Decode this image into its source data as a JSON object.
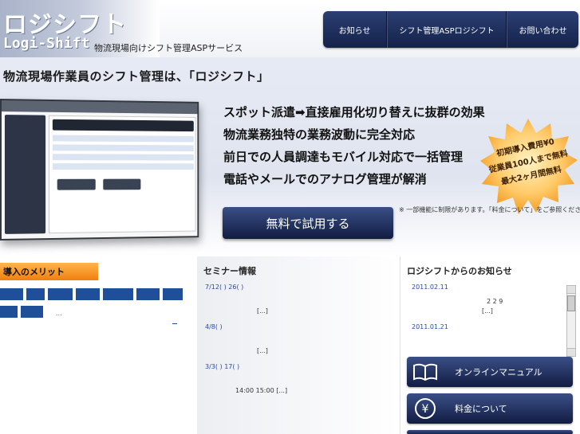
{
  "header": {
    "logo_jp": "ロジシフト",
    "logo_en": "Logi-Shift",
    "tagline": "物流現場向けシフト管理ASPサービス"
  },
  "nav": {
    "items": [
      "お知らせ",
      "シフト管理ASPロジシフト",
      "お問い合わせ"
    ]
  },
  "hero": {
    "heading": "物流現場作業員のシフト管理は、「ロジシフト」",
    "benefits": [
      "スポット派遣➡直接雇用化切り替えに抜群の効果",
      "物流業務独特の業務波動に完全対応",
      "前日での人員調達もモバイル対応で一括管理",
      "電話やメールでのアナログ管理が解消"
    ],
    "burst": {
      "line1": "初期導入費用¥0",
      "line2": "従業員100人まで無料",
      "line3": "最大2ヶ月間無料"
    },
    "trial_button": "無料で試用する",
    "note": "※ 一部機能に制限があります。「料金について」をご参照ください。"
  },
  "merit": {
    "title": "導入のメリット",
    "ellipsis": "...",
    "underscore": "_"
  },
  "seminar": {
    "title": "セミナー情報",
    "entries": [
      {
        "link": "7/12( ) 26( )",
        "more": "[...]"
      },
      {
        "link": "4/8( )",
        "more": "[...]"
      },
      {
        "link": "3/3( ) 17( )",
        "more": "14:00 15:00 [...]"
      }
    ]
  },
  "news": {
    "title": "ロジシフトからのお知らせ",
    "items": [
      {
        "date": "2011.02.11",
        "line1": "2 2 9",
        "line2": "[...]"
      },
      {
        "date": "2011.01.21",
        "line1": "",
        "line2": ""
      }
    ]
  },
  "side_buttons": {
    "manual": "オンラインマニュアル",
    "pricing": "料金について",
    "yen_glyph": "¥"
  },
  "colors": {
    "nav_bg": "#1c2a55",
    "merit_orange": "#f7931e",
    "link_blue": "#2a4aa8"
  }
}
